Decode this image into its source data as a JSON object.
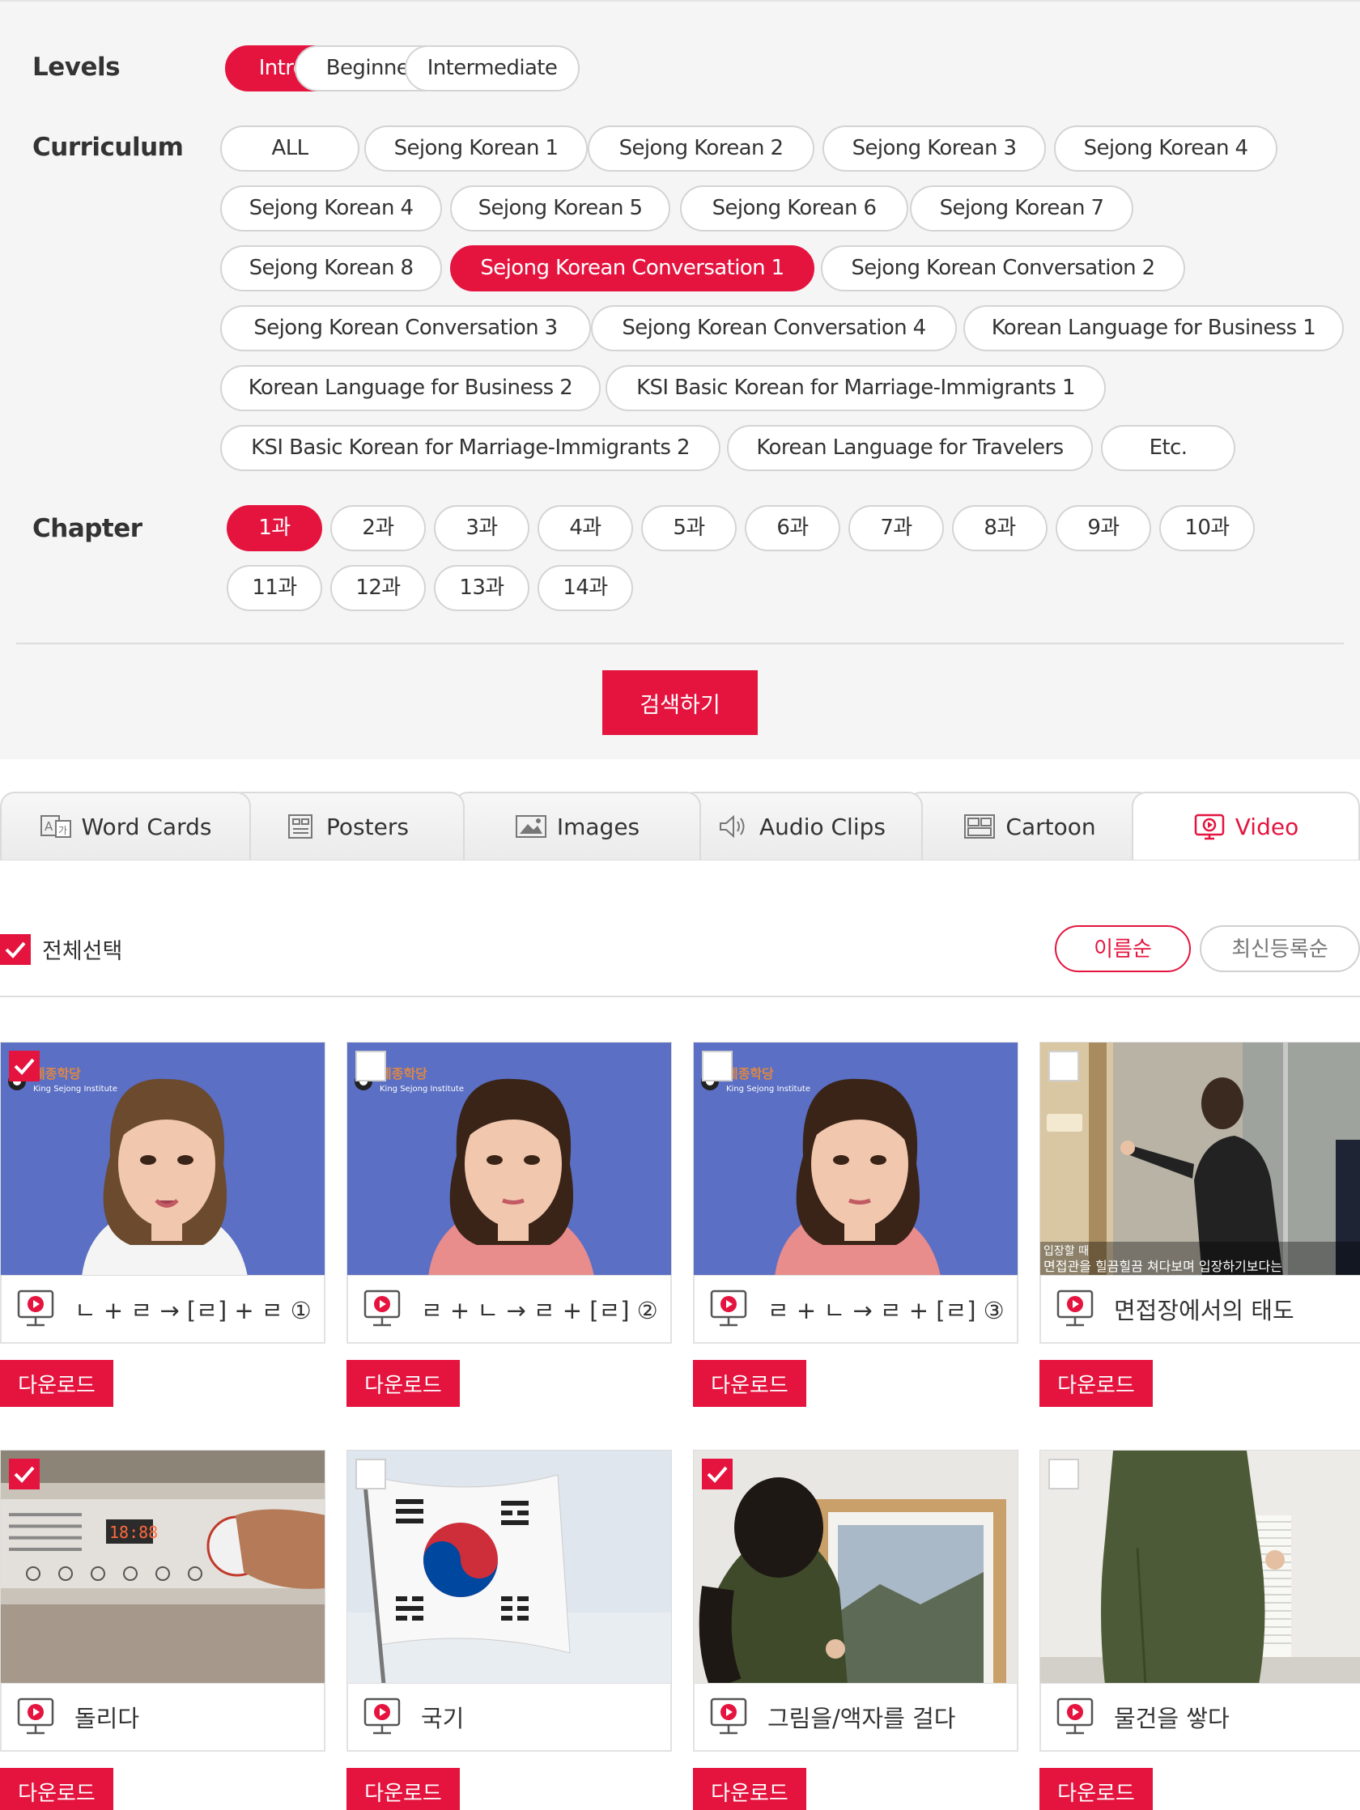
{
  "filters": {
    "levels_label": "Levels",
    "curriculum_label": "Curriculum",
    "chapter_label": "Chapter",
    "levels": [
      "Introductory",
      "Beginner",
      "Intermediate"
    ],
    "curriculum": [
      "ALL",
      "Sejong Korean 1",
      "Sejong Korean 2",
      "Sejong Korean 3",
      "Sejong Korean 4",
      "Sejong Korean 4",
      "Sejong Korean 5",
      "Sejong Korean 6",
      "Sejong Korean 7",
      "Sejong Korean 8",
      "Sejong Korean Conversation 1",
      "Sejong Korean Conversation 2",
      "Sejong Korean Conversation 3",
      "Sejong Korean Conversation 4",
      "Korean Language for Business 1",
      "Korean Language for Business 2",
      "KSI Basic Korean for Marriage-Immigrants 1",
      "KSI Basic Korean for Marriage-Immigrants 2",
      "Korean Language for Travelers",
      "Etc."
    ],
    "chapters": [
      "1과",
      "2과",
      "3과",
      "4과",
      "5과",
      "6과",
      "7과",
      "8과",
      "9과",
      "10과",
      "11과",
      "12과",
      "13과",
      "14과"
    ],
    "selected_level": "Introductory",
    "selected_curriculum": "Sejong Korean Conversation 1",
    "selected_chapter": "1과",
    "search_label": "검색하기"
  },
  "tabs": [
    {
      "label": "Word Cards",
      "icon": "word-cards-icon"
    },
    {
      "label": "Posters",
      "icon": "posters-icon"
    },
    {
      "label": "Images",
      "icon": "images-icon"
    },
    {
      "label": "Audio Clips",
      "icon": "audio-clips-icon"
    },
    {
      "label": "Cartoon",
      "icon": "cartoon-icon"
    },
    {
      "label": "Video",
      "icon": "video-icon"
    }
  ],
  "active_tab": "Video",
  "accent_color": "#e4143f",
  "list": {
    "select_all_label": "전체선택",
    "select_all_checked": true,
    "sort_name_label": "이름순",
    "sort_latest_label": "최신등록순",
    "active_sort": "이름순",
    "download_label": "다운로드",
    "overlay_logo_text": "King Sejong Institute",
    "overlay_subtitle_1": "입장할 때",
    "overlay_subtitle_2": "면접관을 힐끔힐끔 쳐다보며 입장하기보다는"
  },
  "videos": [
    {
      "title": "ㄴ + ㄹ → [ㄹ] + ㄹ ①",
      "checked": true,
      "scene": "presenter"
    },
    {
      "title": "ㄹ + ㄴ → ㄹ + [ㄹ] ②",
      "checked": false,
      "scene": "presenter"
    },
    {
      "title": "ㄹ + ㄴ → ㄹ + [ㄹ] ③",
      "checked": false,
      "scene": "presenter"
    },
    {
      "title": "면접장에서의 태도",
      "checked": false,
      "scene": "interview"
    },
    {
      "title": "돌리다",
      "checked": true,
      "scene": "washer"
    },
    {
      "title": "국기",
      "checked": false,
      "scene": "flag"
    },
    {
      "title": "그림을/액자를 걸다",
      "checked": true,
      "scene": "frame"
    },
    {
      "title": "물건을 쌓다",
      "checked": false,
      "scene": "stack"
    }
  ]
}
